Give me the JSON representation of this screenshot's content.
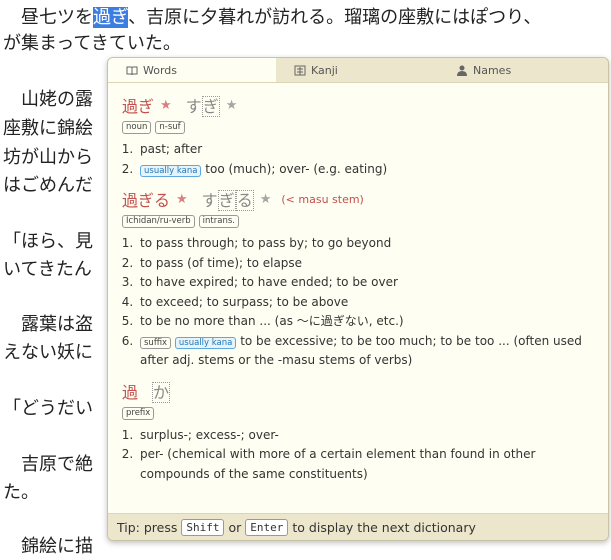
{
  "page": {
    "lines": [
      {
        "before": "　昼七ツを",
        "highlight": "過ぎ",
        "after": "、吉原に夕暮れが訪れる。瑠璃の座敷にはぽつり、"
      },
      {
        "text": "が集まってきていた。"
      },
      {
        "text": "　山姥の露"
      },
      {
        "text": "座敷に錦絵"
      },
      {
        "text": "坊が山から"
      },
      {
        "text": "はごめんだ"
      },
      {
        "text": "「ほら、見"
      },
      {
        "text": "いてきたん"
      },
      {
        "text": "　露葉は盗"
      },
      {
        "text": "えない妖に"
      },
      {
        "text": "「どうだい"
      },
      {
        "text": "　吉原で絶"
      },
      {
        "text": "た。"
      },
      {
        "text": "　錦絵に描"
      }
    ]
  },
  "popup": {
    "tabs": [
      {
        "label": "Words",
        "icon": "book-icon"
      },
      {
        "label": "Kanji",
        "icon": "kanji-icon"
      },
      {
        "label": "Names",
        "icon": "person-icon"
      }
    ],
    "entries": [
      {
        "kanji": "過ぎ",
        "kana": [
          "す",
          "ぎ"
        ],
        "reason": "",
        "tags": [
          "noun",
          "n-suf"
        ],
        "senses": [
          {
            "tags": [],
            "text": "past; after"
          },
          {
            "tags": [
              "usually kana"
            ],
            "text": "too (much); over- (e.g. eating)"
          }
        ]
      },
      {
        "kanji": "過ぎる",
        "kana": [
          "す",
          "ぎ",
          "る"
        ],
        "reason": "(< masu stem)",
        "tags": [
          "Ichidan/ru-verb",
          "intrans."
        ],
        "senses": [
          {
            "tags": [],
            "text": "to pass through; to pass by; to go beyond"
          },
          {
            "tags": [],
            "text": "to pass (of time); to elapse"
          },
          {
            "tags": [],
            "text": "to have expired; to have ended; to be over"
          },
          {
            "tags": [],
            "text": "to exceed; to surpass; to be above"
          },
          {
            "tags": [],
            "text": "to be no more than ... (as ～に過ぎない, etc.)"
          },
          {
            "tags": [
              "suffix",
              "usually kana"
            ],
            "text": "to be excessive; to be too much; to be too ... (often used after adj. stems or the -masu stems of verbs)"
          }
        ]
      },
      {
        "kanji": "過",
        "kana": [
          "か"
        ],
        "reason": "",
        "tags": [
          "prefix"
        ],
        "senses": [
          {
            "tags": [],
            "text": "surplus-; excess-; over-"
          },
          {
            "tags": [],
            "text": "per- (chemical with more of a certain element than found in other compounds of the same constituents)"
          }
        ]
      }
    ],
    "footer": {
      "tip": "Tip: press",
      "key1": "Shift",
      "or": "or",
      "key2": "Enter",
      "rest": "to display the next dictionary"
    }
  }
}
